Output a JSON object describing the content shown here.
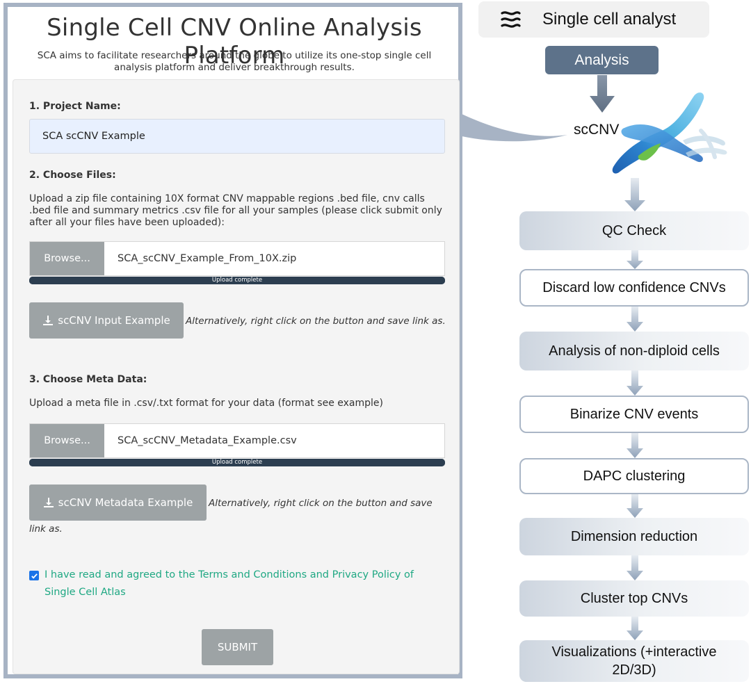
{
  "platform": {
    "title": "Single Cell CNV Online Analysis Platform",
    "subtitle": "SCA aims to facilitate researchers around the globe to utilize its one-stop single cell analysis platform and deliver breakthrough results."
  },
  "form": {
    "project_label": "1. Project Name:",
    "project_value": "SCA scCNV Example",
    "files_label": "2. Choose Files:",
    "files_desc": "Upload a zip file containing 10X format CNV mappable regions .bed file, cnv calls .bed file and summary metrics .csv file for all your samples (please click submit only after all your files have been uploaded):",
    "browse_label": "Browse...",
    "file1_name": "SCA_scCNV_Example_From_10X.zip",
    "upload_status": "Upload complete",
    "upload1_progress": 1.0,
    "input_example_label": "scCNV Input Example",
    "alt_text": "Alternatively, right click on the button and save link as.",
    "meta_label": "3. Choose Meta Data:",
    "meta_desc": "Upload a meta file in .csv/.txt format for your data (format see example)",
    "file2_name": "SCA_scCNV_Metadata_Example.csv",
    "upload2_progress": 1.0,
    "meta_example_label": "scCNV Metadata Example",
    "terms_checked": true,
    "terms_text": "I have read and agreed to the Terms and Conditions and Privacy Policy of Single Cell Atlas",
    "submit_label": "SUBMIT"
  },
  "workflow": {
    "brand_name": "Single cell analyst",
    "analysis_label": "Analysis",
    "sccnv_label": "scCNV",
    "steps": [
      "QC Check",
      "Discard low confidence CNVs",
      "Analysis of non-diploid cells",
      "Binarize CNV events",
      "DAPC clustering",
      "Dimension reduction",
      "Cluster top CNVs",
      "Visualizations (+interactive 2D/3D)"
    ]
  },
  "colors": {
    "panel_border": "#a7b3c4",
    "button_gray": "#9da3a5",
    "progress_dark": "#2c3e50",
    "terms_green": "#1fa883",
    "analysis_blue": "#5d728a",
    "step_border": "#aab6c6"
  }
}
